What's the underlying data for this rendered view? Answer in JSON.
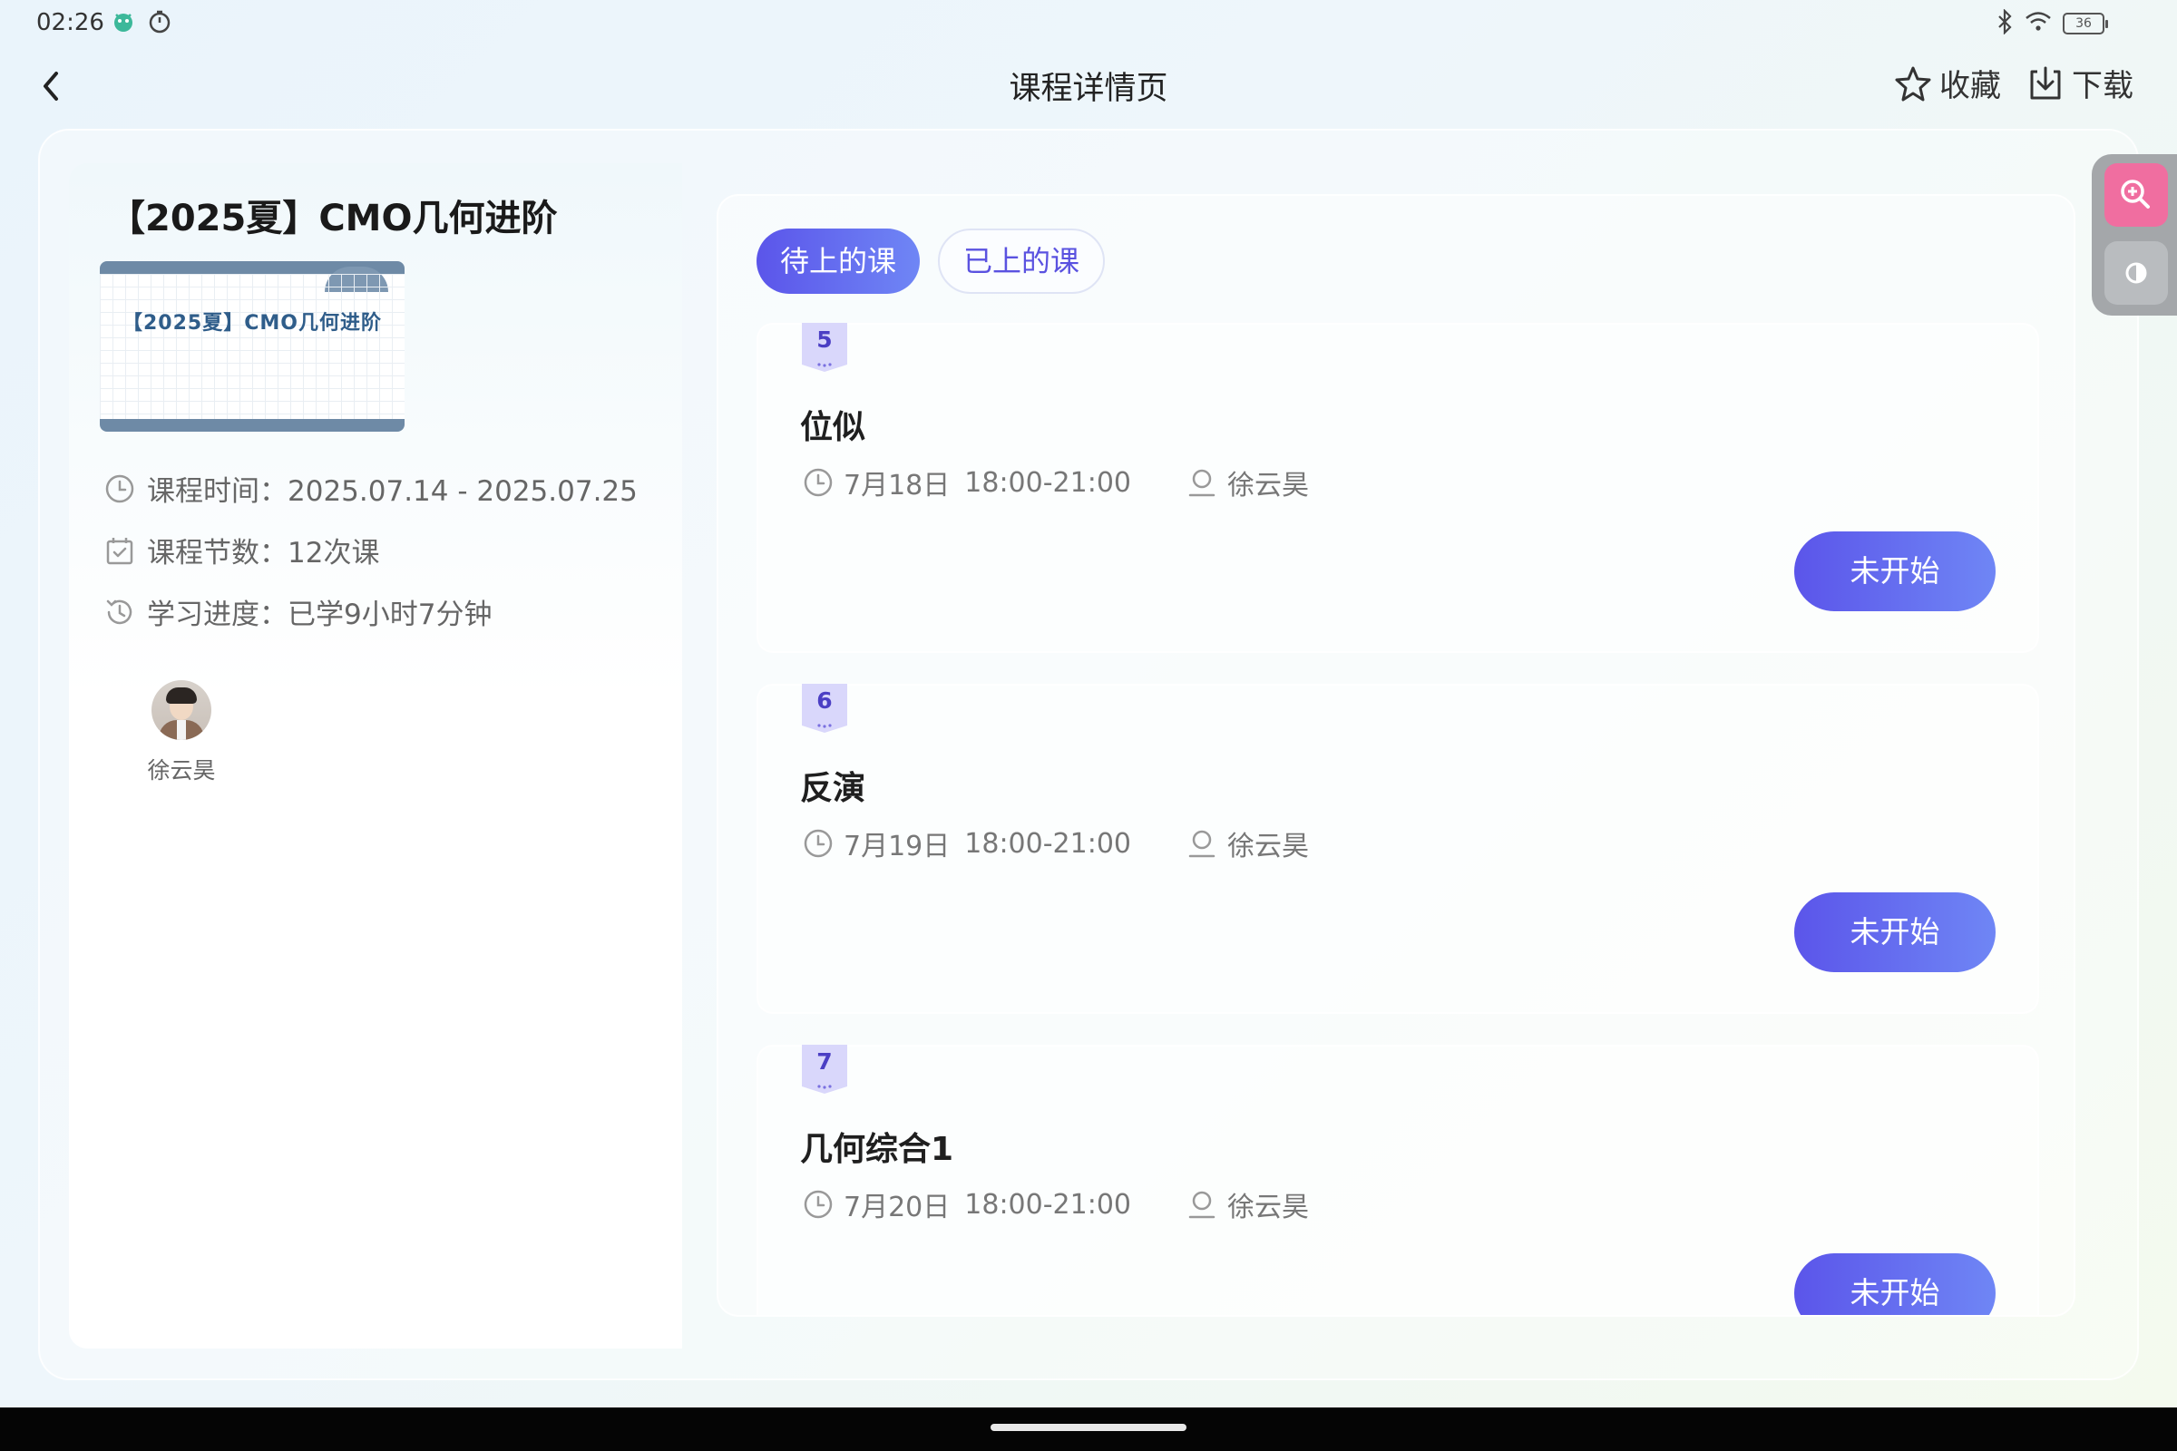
{
  "status_bar": {
    "time": "02:26",
    "battery": "36",
    "icons": [
      "app-notification-icon",
      "timer-icon",
      "bluetooth-icon",
      "wifi-icon",
      "battery-icon"
    ]
  },
  "header": {
    "title": "课程详情页",
    "favorite_label": "收藏",
    "download_label": "下载"
  },
  "course": {
    "title": "【2025夏】CMO几何进阶",
    "cover_text": "【2025夏】CMO几何进阶",
    "time_label": "课程时间：",
    "time_value": "2025.07.14 - 2025.07.25",
    "count_label": "课程节数：",
    "count_value": "12次课",
    "progress_label": "学习进度：",
    "progress_value": "已学9小时7分钟",
    "teacher_name": "徐云昊"
  },
  "tabs": [
    {
      "label": "待上的课",
      "active": true
    },
    {
      "label": "已上的课",
      "active": false
    }
  ],
  "lessons": [
    {
      "number": "5",
      "title": "位似",
      "date": "7月18日",
      "time": "18:00-21:00",
      "teacher": "徐云昊",
      "status": "未开始"
    },
    {
      "number": "6",
      "title": "反演",
      "date": "7月19日",
      "time": "18:00-21:00",
      "teacher": "徐云昊",
      "status": "未开始"
    },
    {
      "number": "7",
      "title": "几何综合1",
      "date": "7月20日",
      "time": "18:00-21:00",
      "teacher": "徐云昊",
      "status": "未开始"
    }
  ],
  "colors": {
    "accent_start": "#5b55ea",
    "accent_end": "#6f86f5",
    "zoom_tool": "#f06ea0"
  }
}
